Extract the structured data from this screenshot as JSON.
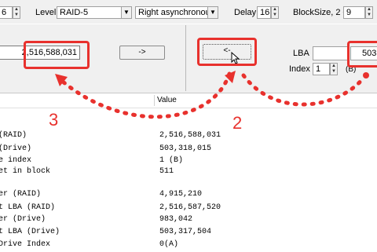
{
  "toolbar": {
    "left_spin_value": "6",
    "level_label": "Level",
    "level_value": "RAID-5",
    "layout_value": "Right asynchronous",
    "delay_label": "Delay",
    "delay_value": "16",
    "blocksize_label": "BlockSize, 2 ^",
    "blocksize_value": "9"
  },
  "panel": {
    "raid_lba_value": "2,516,588,031",
    "forward_button_label": "->",
    "back_button_label": "<-",
    "lba_label": "LBA",
    "lba_value": "503,",
    "index_label": "Index",
    "index_value": "1",
    "index_suffix": "(B)"
  },
  "table": {
    "value_header": "Value",
    "rows": [
      {
        "label": "(RAID)",
        "value": "2,516,588,031"
      },
      {
        "label": "(Drive)",
        "value": "503,318,015"
      },
      {
        "label": "e index",
        "value": "1 (B)"
      },
      {
        "label": "et in block",
        "value": "511"
      },
      {
        "label": "",
        "value": ""
      },
      {
        "label": "er (RAID)",
        "value": "4,915,210"
      },
      {
        "label": "t LBA (RAID)",
        "value": "2,516,587,520"
      },
      {
        "label": "er (Drive)",
        "value": "983,042"
      },
      {
        "label": "t LBA (Drive)",
        "value": "503,317,504"
      },
      {
        "label": "Drive Index",
        "value": "0(A)"
      }
    ]
  },
  "annotations": {
    "step_left": "3",
    "step_right": "2",
    "accent_color": "#e8312d"
  }
}
